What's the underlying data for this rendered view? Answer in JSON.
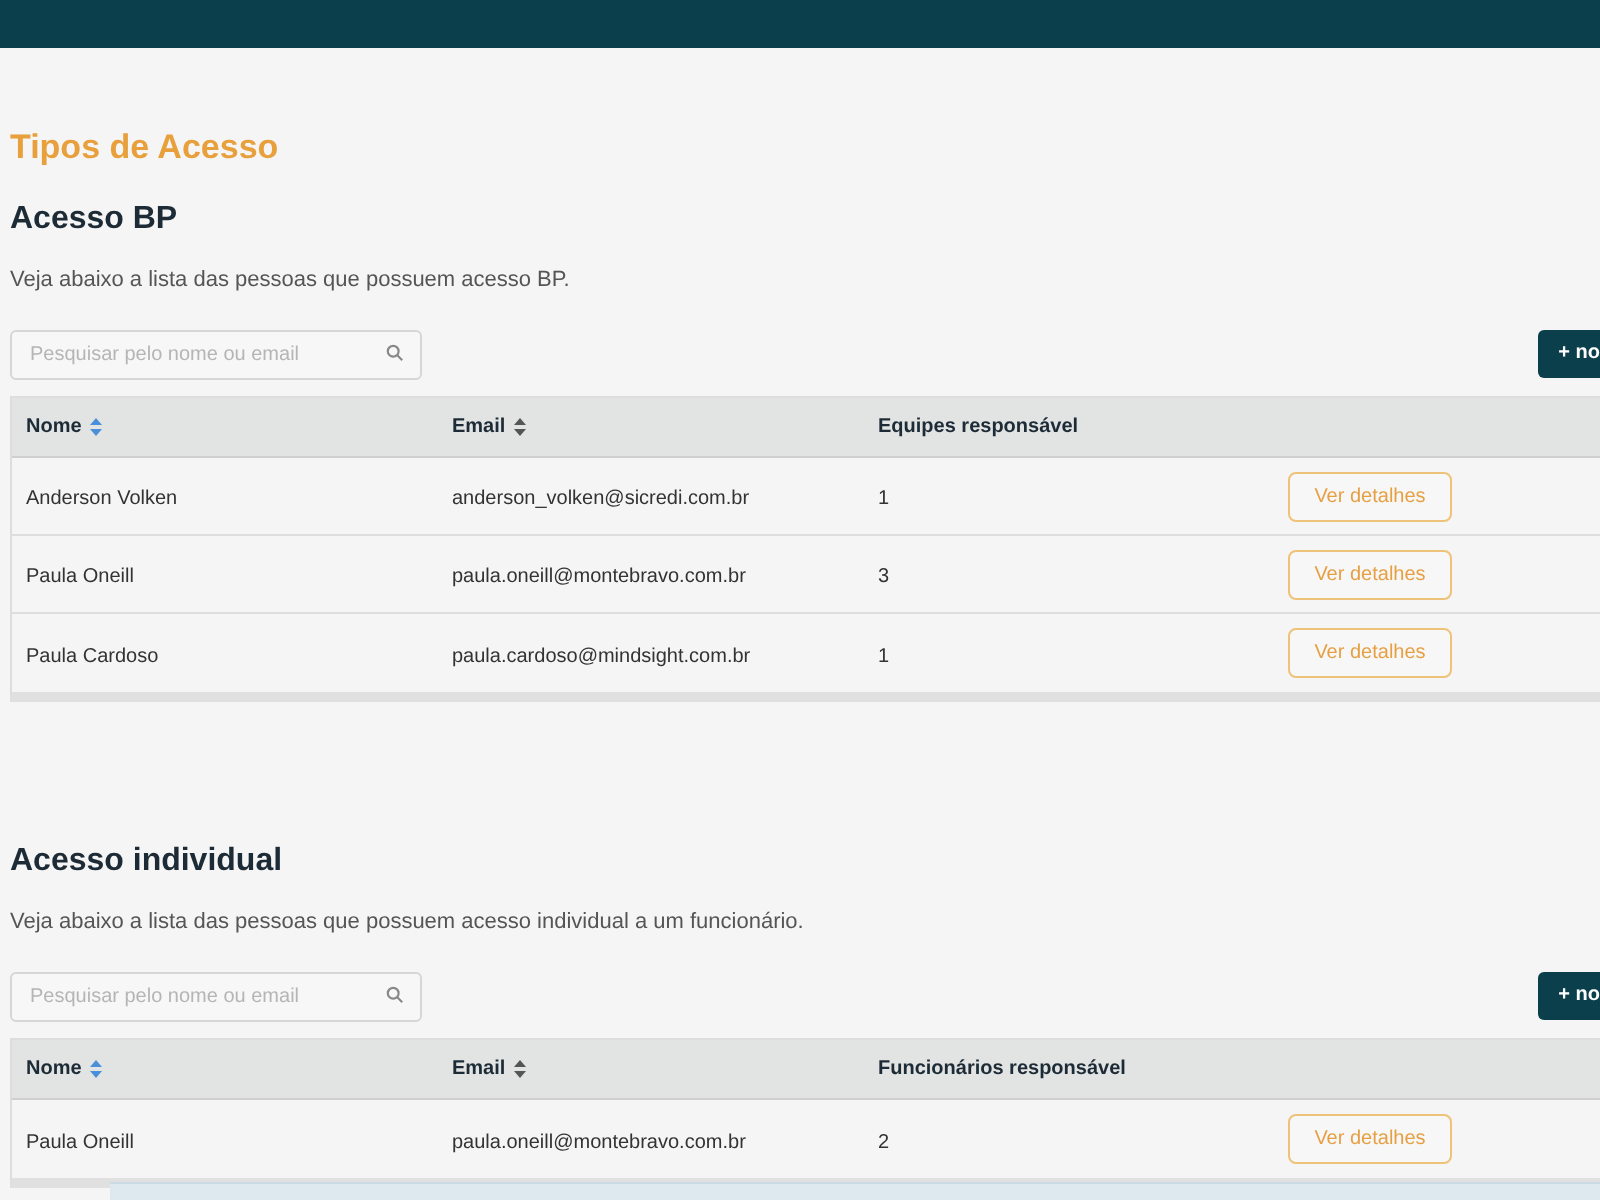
{
  "page_title": "Tipos de Acesso",
  "sections": [
    {
      "title": "Acesso BP",
      "description": "Veja abaixo a lista das pessoas que possuem acesso BP.",
      "search": {
        "placeholder": "Pesquisar pelo nome ou email"
      },
      "add_button": "+ no",
      "columns": [
        {
          "label": "Nome",
          "sorted": true
        },
        {
          "label": "Email",
          "sorted": false
        },
        {
          "label": "Equipes responsável"
        }
      ],
      "rows": [
        {
          "name": "Anderson Volken",
          "email": "anderson_volken@sicredi.com.br",
          "count": "1",
          "action": "Ver detalhes"
        },
        {
          "name": "Paula Oneill",
          "email": "paula.oneill@montebravo.com.br",
          "count": "3",
          "action": "Ver detalhes"
        },
        {
          "name": "Paula Cardoso",
          "email": "paula.cardoso@mindsight.com.br",
          "count": "1",
          "action": "Ver detalhes"
        }
      ]
    },
    {
      "title": "Acesso individual",
      "description": "Veja abaixo a lista das pessoas que possuem acesso individual a um funcionário.",
      "search": {
        "placeholder": "Pesquisar pelo nome ou email"
      },
      "add_button": "+ no",
      "columns": [
        {
          "label": "Nome",
          "sorted": true
        },
        {
          "label": "Email",
          "sorted": false
        },
        {
          "label": "Funcionários responsável"
        }
      ],
      "rows": [
        {
          "name": "Paula Oneill",
          "email": "paula.oneill@montebravo.com.br",
          "count": "2",
          "action": "Ver detalhes"
        }
      ]
    }
  ]
}
